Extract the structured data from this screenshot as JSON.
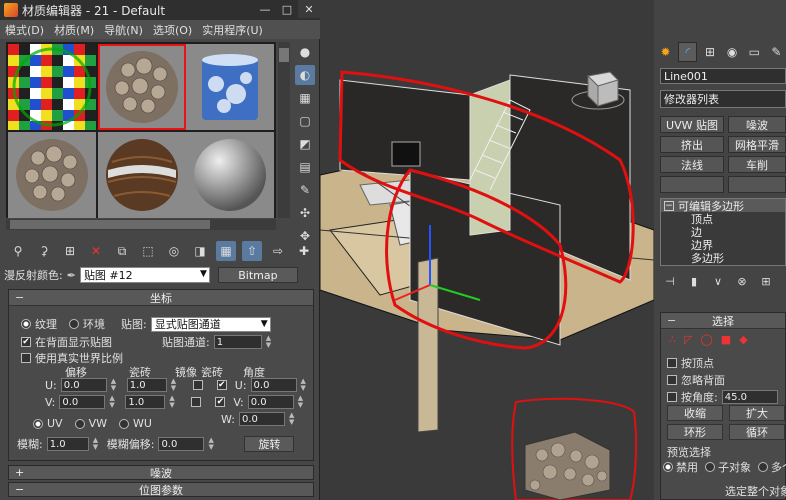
{
  "material_editor": {
    "title": "材质编辑器 - 21 - Default",
    "window_buttons": [
      "—",
      "□",
      "✕"
    ],
    "menu": [
      "模式(D)",
      "材质(M)",
      "导航(N)",
      "选项(O)",
      "实用程序(U)"
    ],
    "slot_count": 6,
    "active_slot": 1,
    "material_name_label": "漫反射颜色:",
    "material_name": "贴图 #12",
    "material_type": "Bitmap",
    "coords_rollout": {
      "title": "坐标",
      "texture_label": "纹理",
      "env_label": "环境",
      "mapping_label": "贴图:",
      "mapping_value": "显式贴图通道",
      "show_back_label": "在背面显示贴图",
      "map_channel_label": "贴图通道:",
      "map_channel_value": "1",
      "real_world_label": "使用真实世界比例",
      "offset_label": "偏移",
      "tiling_label": "瓷砖",
      "mirror_label": "镜像",
      "tile_label": "瓷砖",
      "angle_label": "角度",
      "u_label": "U:",
      "v_label": "V:",
      "w_label": "W:",
      "u_offset": "0.0",
      "v_offset": "0.0",
      "u_tiling": "1.0",
      "v_tiling": "1.0",
      "u_angle": "0.0",
      "v_angle": "0.0",
      "w_angle": "0.0",
      "uv_label": "UV",
      "vw_label": "VW",
      "wu_label": "WU",
      "blur_label": "模糊:",
      "blur_value": "1.0",
      "blur_offset_label": "模糊偏移:",
      "blur_offset_value": "0.0",
      "rotate_label": "旋转"
    },
    "noise_rollout": "噪波",
    "bitmap_params_rollout": "位图参数",
    "plus_sign": "+",
    "minus_sign": "−"
  },
  "command_panel": {
    "object_name": "Line001",
    "modifier_list": "修改器列表",
    "modifier_buttons": [
      "UVW 贴图",
      "噪波",
      "挤出",
      "网格平滑",
      "法线",
      "车削"
    ],
    "stack": [
      "可编辑多边形",
      "顶点",
      "边",
      "边界",
      "多边形"
    ],
    "selection_rollout": "选择",
    "by_vertex": "按顶点",
    "ignore_backfacing": "忽略背面",
    "by_angle": "按角度:",
    "angle_value": "45.0",
    "shrink": "收缩",
    "grow": "扩大",
    "ring": "环形",
    "loop": "循环",
    "preview_selection": "预览选择",
    "disabled": "禁用",
    "sub_object": "子对象",
    "multi": "多个",
    "selected_whole": "选定整个对象"
  },
  "colors": {
    "selection_red": "#e01010",
    "panel_bg": "#464646"
  }
}
